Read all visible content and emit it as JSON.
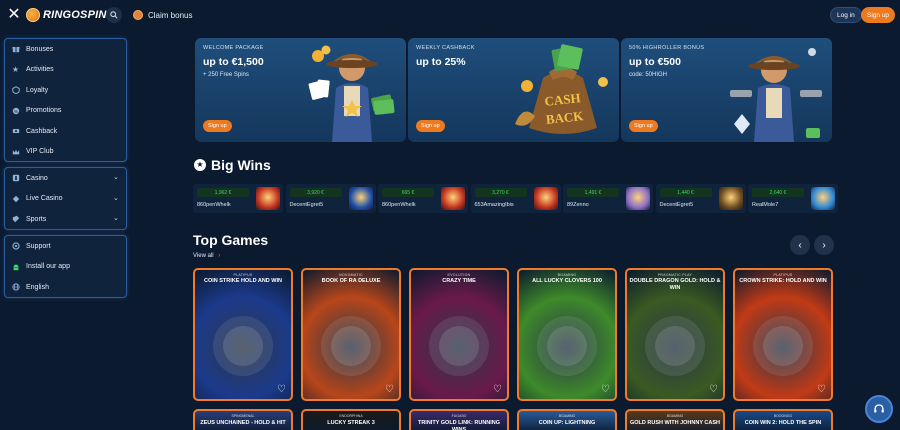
{
  "header": {
    "logo_text": "RINGOSPIN",
    "claim_bonus": "Claim bonus",
    "login": "Log in",
    "signup": "Sign up"
  },
  "sidebar": {
    "group1": [
      {
        "label": "Bonuses",
        "icon": "gift-icon"
      },
      {
        "label": "Activities",
        "icon": "star-icon"
      },
      {
        "label": "Loyalty",
        "icon": "loyalty-icon"
      },
      {
        "label": "Promotions",
        "icon": "promotions-icon"
      },
      {
        "label": "Cashback",
        "icon": "cashback-icon"
      },
      {
        "label": "VIP Club",
        "icon": "crown-icon"
      }
    ],
    "group2": [
      {
        "label": "Casino",
        "icon": "casino-icon"
      },
      {
        "label": "Live Casino",
        "icon": "live-casino-icon"
      },
      {
        "label": "Sports",
        "icon": "sports-icon"
      }
    ],
    "group3": [
      {
        "label": "Support",
        "icon": "support-icon"
      },
      {
        "label": "Install our app",
        "icon": "android-icon"
      },
      {
        "label": "English",
        "icon": "globe-icon"
      }
    ]
  },
  "promos": [
    {
      "tag": "WELCOME PACKAGE",
      "headline": "up to €1,500",
      "sub": "+ 250 Free Spins",
      "cta": "Sign up"
    },
    {
      "tag": "WEEKLY CASHBACK",
      "headline": "up to 25%",
      "sub": "",
      "cta": "Sign up"
    },
    {
      "tag": "50% HIGHROLLER BONUS",
      "headline": "up to €500",
      "sub": "code: 50HIGH",
      "cta": "Sign up"
    }
  ],
  "big_wins": {
    "title": "Big Wins",
    "items": [
      {
        "amount": "1,962 €",
        "user": "860penWhelk",
        "color": "#c2311e"
      },
      {
        "amount": "3,920 €",
        "user": "DecentEgret5",
        "color": "#1d4fa8"
      },
      {
        "amount": "665 €",
        "user": "860penWhelk",
        "color": "#c2311e"
      },
      {
        "amount": "3,270 €",
        "user": "653AmazingIbis",
        "color": "#c2311e"
      },
      {
        "amount": "1,491 €",
        "user": "89Zenno",
        "color": "#8a6fc9"
      },
      {
        "amount": "1,440 €",
        "user": "DecentEgret5",
        "color": "#6b4a1e"
      },
      {
        "amount": "2,640 €",
        "user": "RealMole7",
        "color": "#2f88d6"
      }
    ]
  },
  "top_games": {
    "title": "Top Games",
    "view_all": "View all",
    "row1": [
      {
        "provider": "PLATIPUS",
        "title": "COIN STRIKE HOLD AND WIN",
        "bg": "#1c3a8c"
      },
      {
        "provider": "NOVOMATIC",
        "title": "BOOK OF RA DELUXE",
        "bg": "#b8461a"
      },
      {
        "provider": "EVOLUTION",
        "title": "CRAZY TIME",
        "bg": "#6a1a4a"
      },
      {
        "provider": "BGAMING",
        "title": "ALL LUCKY CLOVERS 100",
        "bg": "#3e8a2a"
      },
      {
        "provider": "PRAGMATIC PLAY",
        "title": "DOUBLE DRAGON GOLD: HOLD & WIN",
        "bg": "#3a5a22"
      },
      {
        "provider": "PLATIPUS",
        "title": "CROWN STRIKE: HOLD AND WIN",
        "bg": "#c23a16"
      }
    ],
    "row2": [
      {
        "provider": "SPINOMENAL",
        "title": "ZEUS UNCHAINED - HOLD & HIT",
        "bg": "#2a3d78"
      },
      {
        "provider": "ENDORPHINA",
        "title": "LUCKY STREAK 3",
        "bg": "#1a1a1a"
      },
      {
        "provider": "FUGASO",
        "title": "TRINITY GOLD LINK: RUNNING WINS",
        "bg": "#3a2a6a"
      },
      {
        "provider": "BGAMING",
        "title": "COIN UP: LIGHTNING",
        "bg": "#2a5a9a"
      },
      {
        "provider": "BGAMING",
        "title": "GOLD RUSH WITH JOHNNY CASH",
        "bg": "#5a3a1a"
      },
      {
        "provider": "BOOONGO",
        "title": "COIN WIN 2: HOLD THE SPIN",
        "bg": "#1a4a8a"
      }
    ]
  },
  "colors": {
    "accent": "#ee7a1f",
    "bg": "#0b1a2e",
    "win_green": "#3fd56a"
  }
}
